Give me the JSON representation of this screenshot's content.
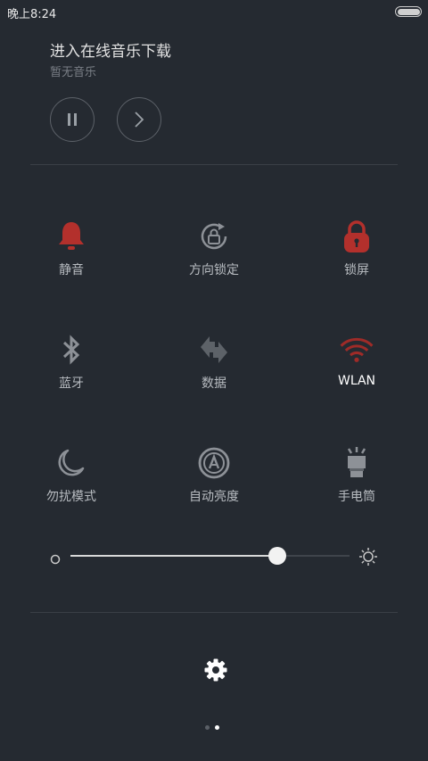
{
  "status_bar": {
    "time": "晚上8:24",
    "battery_level": 1.0
  },
  "music": {
    "title": "进入在线音乐下载",
    "subtitle": "暂无音乐"
  },
  "toggles": [
    {
      "key": "mute",
      "label": "静音",
      "icon": "bell-icon",
      "active": true
    },
    {
      "key": "rotation_lock",
      "label": "方向锁定",
      "icon": "rotation-lock-icon",
      "active": false
    },
    {
      "key": "lock_screen",
      "label": "锁屏",
      "icon": "lock-icon",
      "active": true
    },
    {
      "key": "bluetooth",
      "label": "蓝牙",
      "icon": "bluetooth-icon",
      "active": false
    },
    {
      "key": "data",
      "label": "数据",
      "icon": "data-arrows-icon",
      "active": false
    },
    {
      "key": "wlan",
      "label": "WLAN",
      "icon": "wifi-icon",
      "active": true
    },
    {
      "key": "dnd",
      "label": "勿扰模式",
      "icon": "moon-icon",
      "active": false
    },
    {
      "key": "auto_brightness",
      "label": "自动亮度",
      "icon": "auto-brightness-icon",
      "active": false
    },
    {
      "key": "flashlight",
      "label": "手电筒",
      "icon": "flashlight-icon",
      "active": false
    }
  ],
  "brightness": {
    "level": 0.74
  },
  "pager": {
    "pages": 2,
    "current": 2
  },
  "colors": {
    "background": "#252a31",
    "active_red": "#b3302c",
    "inactive_icon": "#8d9197",
    "label": "#b8bcc1"
  }
}
